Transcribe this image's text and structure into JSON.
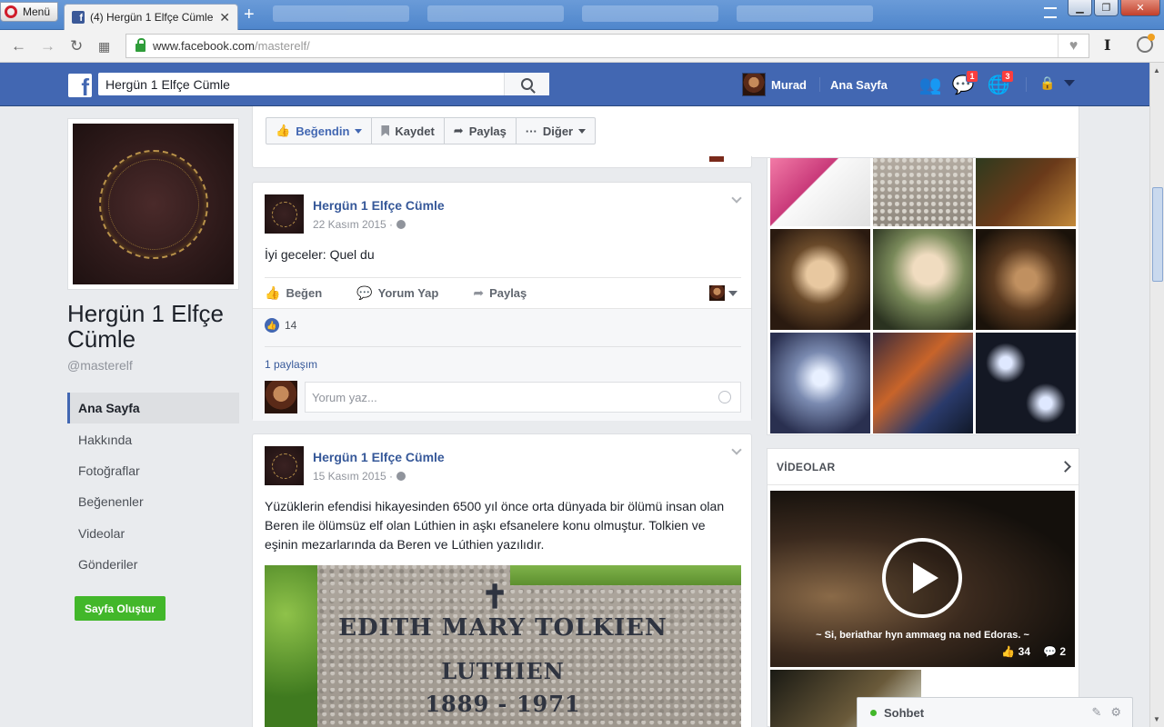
{
  "browser": {
    "menu_label": "Menü",
    "tab_title": "(4) Hergün 1 Elfçe Cümle",
    "url_domain": "www.facebook.com",
    "url_path": "/masterelf/"
  },
  "topbar": {
    "search_value": "Hergün 1 Elfçe Cümle",
    "user_name": "Murad",
    "home_label": "Ana Sayfa",
    "messages_badge": "1",
    "notifications_badge": "3"
  },
  "page": {
    "name": "Hergün 1 Elfçe Cümle",
    "handle": "@masterelf",
    "nav": [
      {
        "label": "Ana Sayfa"
      },
      {
        "label": "Hakkında"
      },
      {
        "label": "Fotoğraflar"
      },
      {
        "label": "Beğenenler"
      },
      {
        "label": "Videolar"
      },
      {
        "label": "Gönderiler"
      }
    ],
    "create_page_label": "Sayfa Oluştur"
  },
  "actions": {
    "liked_label": "Beğendin",
    "save_label": "Kaydet",
    "share_label": "Paylaş",
    "more_label": "Diğer"
  },
  "posts": [
    {
      "author": "Hergün 1 Elfçe Cümle",
      "date": "22 Kasım 2015 ·",
      "text": "İyi geceler: Quel du",
      "like_label": "Beğen",
      "comment_label": "Yorum Yap",
      "share_label": "Paylaş",
      "like_count": "14",
      "shares": "1 paylaşım",
      "comment_placeholder": "Yorum yaz..."
    },
    {
      "author": "Hergün 1 Elfçe Cümle",
      "date": "15 Kasım 2015 ·",
      "text": "Yüzüklerin efendisi hikayesinden 6500 yıl önce orta dünyada bir ölümü insan olan Beren ile ölümsüz elf olan Lúthien in aşkı efsanelere konu olmuştur. Tolkien ve eşinin mezarlarında da Beren ve Lúthien yazılıdır.",
      "image_text": [
        "EDITH MARY TOLKIEN",
        "LUTHIEN",
        "1889 - 1971"
      ]
    }
  ],
  "videos": {
    "title": "VİDEOLAR",
    "caption": "~ Si, beriathar hyn ammaeg na ned Edoras. ~",
    "likes": "34",
    "comments": "2"
  },
  "chat": {
    "label": "Sohbet"
  },
  "colors": {
    "fb_blue": "#4267b2",
    "link_blue": "#365899",
    "green": "#42b72a",
    "badge_red": "#fa3e3e"
  }
}
